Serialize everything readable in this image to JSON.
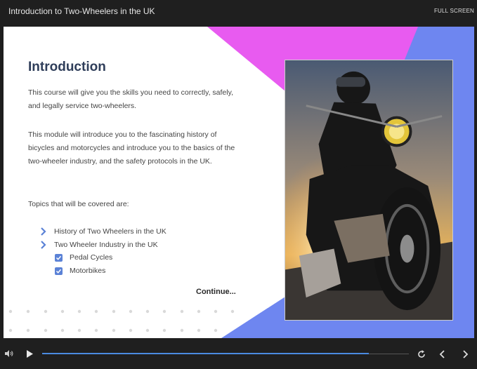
{
  "header": {
    "title": "Introduction to Two-Wheelers in the UK",
    "fullscreen_label": "FULL SCREEN"
  },
  "slide": {
    "heading": "Introduction",
    "paragraphs": [
      "This course will give you the skills you need to correctly, safely, and legally service two-wheelers.",
      "This module will introduce you to the fascinating history of bicycles and motorcycles and introduce you to the basics of the two-wheeler industry, and the safety protocols in the UK.",
      "Topics that will be covered are:"
    ],
    "topics": [
      "History of Two Wheelers in the UK",
      "Two Wheeler Industry in the UK"
    ],
    "subtopics": [
      "Pedal Cycles",
      "Motorbikes"
    ],
    "continue_label": "Continue...",
    "image_subject": "motorcyclist riding a cruiser motorcycle at sunset"
  },
  "player": {
    "progress_fraction": 0.89,
    "icons": [
      "volume-icon",
      "play-icon",
      "replay-icon",
      "previous-icon",
      "next-icon"
    ]
  },
  "colors": {
    "accent_blue": "#6e86f0",
    "accent_magenta": "#e85bf0",
    "heading": "#2f3e5a",
    "checkbox": "#5b82d6",
    "progress": "#4a8be0"
  }
}
